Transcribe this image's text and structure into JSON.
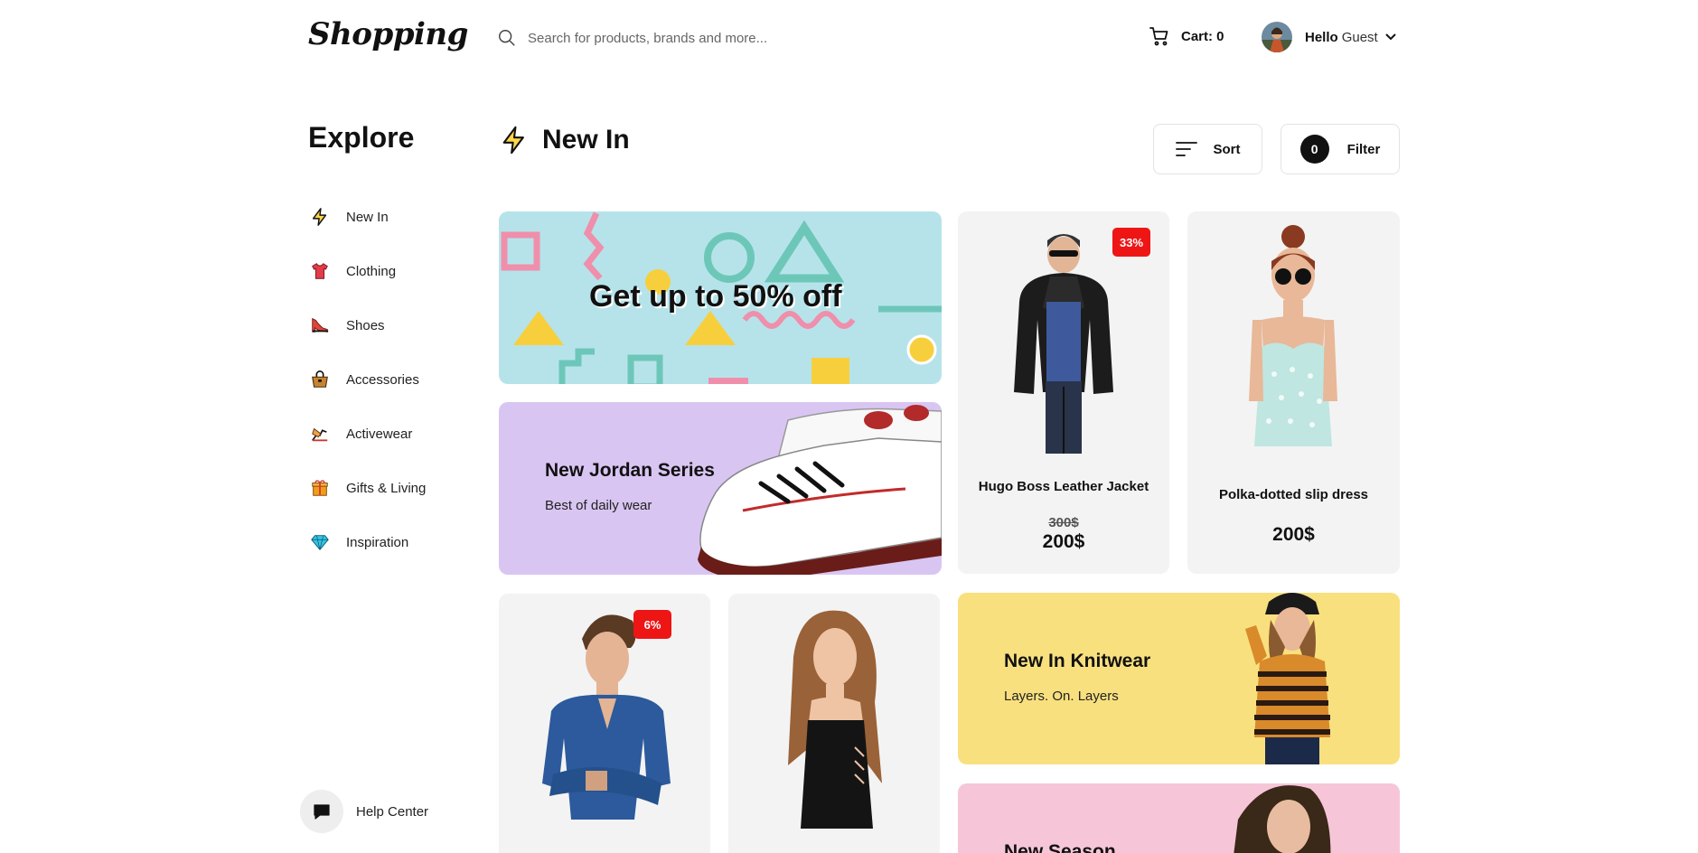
{
  "header": {
    "logo": "Shopping",
    "search_placeholder": "Search for products, brands and more...",
    "cart_label": "Cart: 0",
    "greeting": "Hello",
    "user_name": "Guest"
  },
  "sidebar": {
    "title": "Explore",
    "items": [
      {
        "label": "New In",
        "icon": "lightning-icon"
      },
      {
        "label": "Clothing",
        "icon": "tshirt-icon"
      },
      {
        "label": "Shoes",
        "icon": "heel-shoe-icon"
      },
      {
        "label": "Accessories",
        "icon": "handbag-icon"
      },
      {
        "label": "Activewear",
        "icon": "activewear-icon"
      },
      {
        "label": "Gifts & Living",
        "icon": "gift-icon"
      },
      {
        "label": "Inspiration",
        "icon": "diamond-icon"
      }
    ],
    "help_label": "Help Center"
  },
  "main": {
    "title": "New In",
    "sort_label": "Sort",
    "filter_label": "Filter",
    "filter_count": "0"
  },
  "banners": {
    "sale": "Get up to 50% off",
    "jordan": {
      "title": "New Jordan Series",
      "subtitle": "Best of daily wear"
    },
    "knit": {
      "title": "New In Knitwear",
      "subtitle": "Layers. On. Layers"
    },
    "season": {
      "title": "New Season"
    }
  },
  "products": [
    {
      "title": "Hugo Boss Leather Jacket",
      "old_price": "300$",
      "price": "200$",
      "badge": "33%"
    },
    {
      "title": "Polka-dotted slip dress",
      "price": "200$"
    },
    {
      "badge": "6%"
    },
    {}
  ],
  "colors": {
    "sale_bg": "#b6e3ea",
    "jordan_bg": "#d9c5f2",
    "knit_bg": "#f9e07e",
    "season_bg": "#f6c6d8",
    "badge": "#ee1515",
    "product_bg": "#f3f3f3"
  }
}
